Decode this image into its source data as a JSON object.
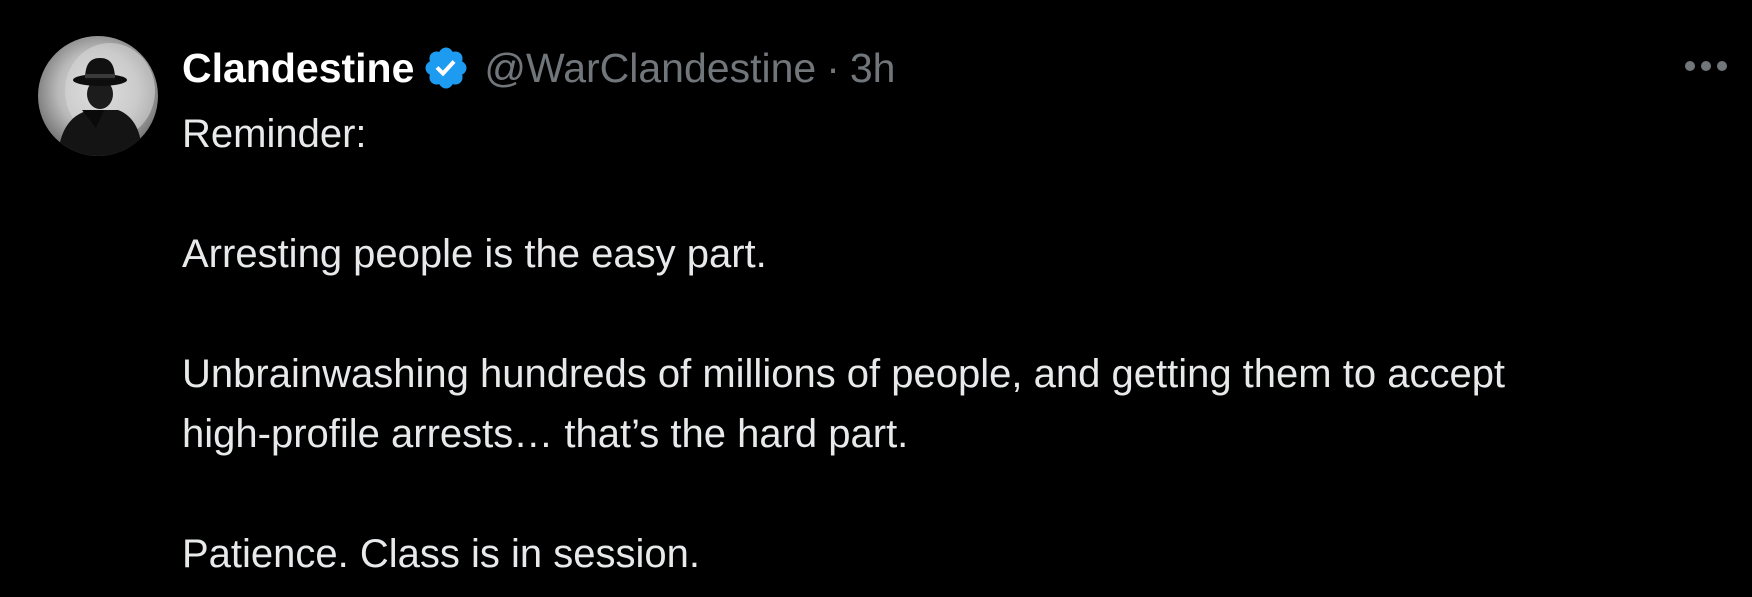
{
  "tweet": {
    "author": {
      "display_name": "Clandestine",
      "handle": "@WarClandestine",
      "verified": true,
      "avatar_icon": "noir-detective-avatar"
    },
    "separator": "·",
    "timestamp": "3h",
    "more_icon": "more-horizontal-icon",
    "text_lines": {
      "l1": "Reminder:",
      "l2": "Arresting people is the easy part.",
      "l3": "Unbrainwashing hundreds of millions of people, and getting them to accept",
      "l4": "high-profile arrests… that’s the hard part.",
      "l5": "Patience. Class is in session."
    }
  },
  "colors": {
    "background": "#000000",
    "text": "#e7e9ea",
    "secondary_text": "#71767b",
    "verified": "#1d9bf0"
  }
}
